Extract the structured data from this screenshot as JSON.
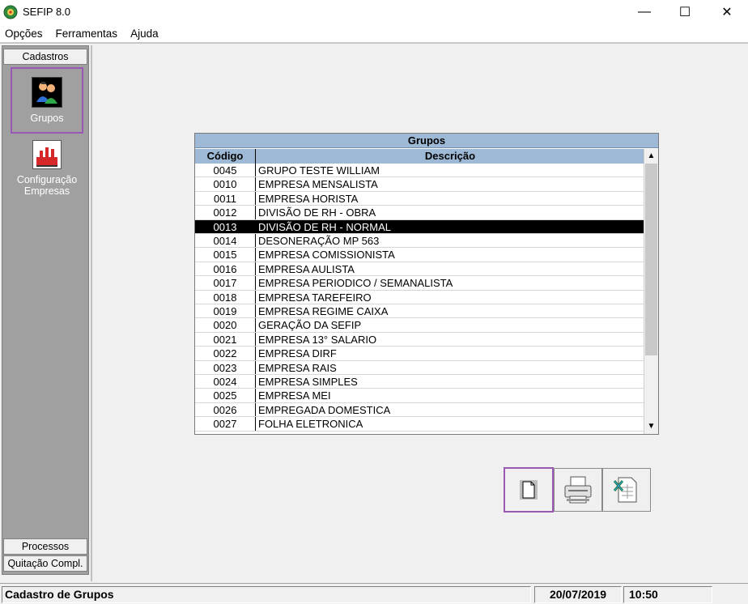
{
  "window": {
    "title": "SEFIP 8.0",
    "min_symbol": "—",
    "max_symbol": "☐",
    "close_symbol": "✕"
  },
  "menu": [
    "Opções",
    "Ferramentas",
    "Ajuda"
  ],
  "sidebar": {
    "header_top": "Cadastros",
    "items": [
      {
        "label": "Grupos",
        "icon": "users-icon"
      },
      {
        "label": "Configuração Empresas",
        "icon": "factory-icon"
      }
    ],
    "header_bottom1": "Processos",
    "header_bottom2": "Quitação Compl."
  },
  "grid": {
    "title": "Grupos",
    "col_code": "Código",
    "col_desc": "Descrição",
    "selected_row": 4,
    "rows": [
      {
        "code": "0045",
        "desc": "GRUPO TESTE WILLIAM"
      },
      {
        "code": "0010",
        "desc": "EMPRESA MENSALISTA"
      },
      {
        "code": "0011",
        "desc": "EMPRESA HORISTA"
      },
      {
        "code": "0012",
        "desc": "DIVISÃO DE RH - OBRA"
      },
      {
        "code": "0013",
        "desc": "DIVISÃO DE RH - NORMAL"
      },
      {
        "code": "0014",
        "desc": "DESONERAÇÃO MP 563"
      },
      {
        "code": "0015",
        "desc": "EMPRESA COMISSIONISTA"
      },
      {
        "code": "0016",
        "desc": "EMPRESA AULISTA"
      },
      {
        "code": "0017",
        "desc": "EMPRESA PERIODICO / SEMANALISTA"
      },
      {
        "code": "0018",
        "desc": "EMPRESA TAREFEIRO"
      },
      {
        "code": "0019",
        "desc": "EMPRESA REGIME CAIXA"
      },
      {
        "code": "0020",
        "desc": "GERAÇÃO DA SEFIP"
      },
      {
        "code": "0021",
        "desc": "EMPRESA 13° SALARIO"
      },
      {
        "code": "0022",
        "desc": "EMPRESA DIRF"
      },
      {
        "code": "0023",
        "desc": "EMPRESA RAIS"
      },
      {
        "code": "0024",
        "desc": "EMPRESA SIMPLES"
      },
      {
        "code": "0025",
        "desc": "EMPRESA MEI"
      },
      {
        "code": "0026",
        "desc": "EMPREGADA DOMESTICA"
      },
      {
        "code": "0027",
        "desc": "FOLHA ELETRONICA"
      }
    ]
  },
  "actions": [
    {
      "name": "new-document",
      "icon": "new-document-icon"
    },
    {
      "name": "print",
      "icon": "printer-icon"
    },
    {
      "name": "export-excel",
      "icon": "excel-icon"
    }
  ],
  "status": {
    "text": "Cadastro de Grupos",
    "date": "20/07/2019",
    "time": "10:50"
  },
  "colors": {
    "highlight": "#9b59b6",
    "grid_header": "#9db9d5",
    "selected_row": "#000000"
  }
}
